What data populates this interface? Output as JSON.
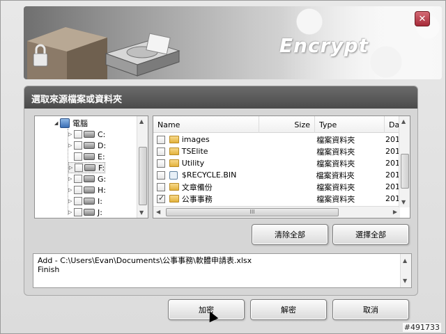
{
  "window": {
    "app_title": "Encrypt",
    "close_label": "✕"
  },
  "panel": {
    "title": "選取來源檔案或資料夾"
  },
  "tree": {
    "root_label": "電腦",
    "drives": [
      "C:",
      "D:",
      "E:",
      "F:",
      "G:",
      "H:",
      "I:",
      "J:"
    ]
  },
  "list": {
    "columns": [
      "Name",
      "Size",
      "Type",
      "Dat"
    ],
    "rows": [
      {
        "name": "images",
        "type": "檔案資料夾",
        "date": "201",
        "checked": false,
        "icon": "folder-icon"
      },
      {
        "name": "TSElite",
        "type": "檔案資料夾",
        "date": "201",
        "checked": false,
        "icon": "folder-icon"
      },
      {
        "name": "Utility",
        "type": "檔案資料夾",
        "date": "201",
        "checked": false,
        "icon": "folder-icon"
      },
      {
        "name": "$RECYCLE.BIN",
        "type": "檔案資料夾",
        "date": "201",
        "checked": false,
        "icon": "recycle-bin-icon"
      },
      {
        "name": "文章備份",
        "type": "檔案資料夾",
        "date": "201",
        "checked": false,
        "icon": "folder-icon"
      },
      {
        "name": "公事事務",
        "type": "檔案資料夾",
        "date": "201",
        "checked": true,
        "icon": "folder-icon"
      }
    ],
    "hscroll_grip": "III"
  },
  "buttons": {
    "clear_all": "清除全部",
    "select_all": "選擇全部",
    "encrypt": "加密",
    "decrypt": "解密",
    "cancel": "取消"
  },
  "log": {
    "line1": "Add - C:\\Users\\Evan\\Documents\\公事事務\\軟體申請表.xlsx",
    "line2": "Finish"
  },
  "watermark": "#491733",
  "colors": {
    "title_bar": "#4a4a4a",
    "close_button": "#a62a38",
    "folder": "#e3b23c"
  }
}
